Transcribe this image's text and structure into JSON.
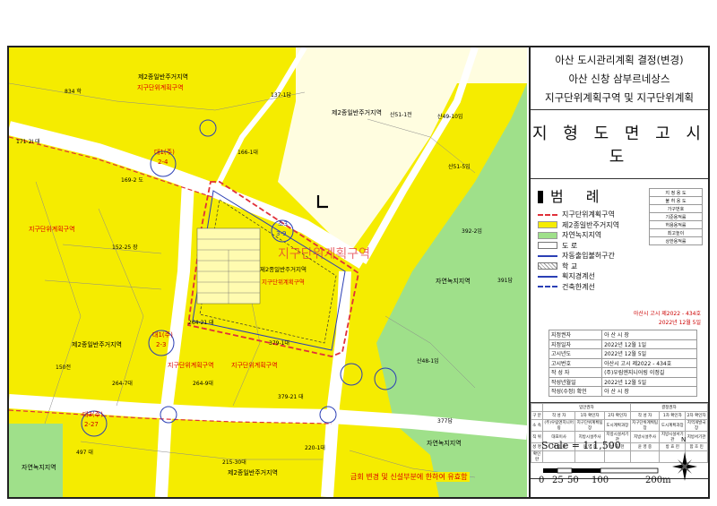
{
  "title": {
    "line1": "아산 도시관리계획 결정(변경)",
    "line2": "아산 신창 삼부르네상스",
    "line3": "지구단위계획구역 및 지구단위계획"
  },
  "subtitle": "지 형 도 면 고 시 도",
  "legend": {
    "heading": "범 례",
    "items": [
      {
        "label": "지구단위계획구역",
        "color": "#e0303a"
      },
      {
        "label": "제2종일반주거지역",
        "color": "#f5ec00"
      },
      {
        "label": "자연녹지지역",
        "color": "#9fe08a"
      },
      {
        "label": "도 로",
        "color": "#ffffff"
      },
      {
        "label": "자동출입불허구간",
        "color": "#2b3fb5"
      },
      {
        "label": "학 교",
        "color": "#ffffff"
      },
      {
        "label": "획지경계선",
        "color": "#2b3fb5"
      },
      {
        "label": "건축한계선",
        "color": "#2b3fb5"
      }
    ],
    "table_rows": [
      "지 정 용 도",
      "불 허 용 도",
      "가구번호",
      "기준용적률",
      "허용용적률",
      "최고높이",
      "상한용적률"
    ],
    "table_right": [
      "",
      "",
      "",
      "",
      "",
      "",
      ""
    ]
  },
  "notice": {
    "line1": "아산시 고시 제2022 - 434호",
    "line2": "2022년  12월  5일"
  },
  "info_rows": [
    {
      "k": "지정권자",
      "v": "아 산 시 장"
    },
    {
      "k": "지정일자",
      "v": "2022년  12월  1일"
    },
    {
      "k": "고시년도",
      "v": "2022년  12월  5일"
    },
    {
      "k": "고시번호",
      "v": "아산시 고시 제2022 - 434호"
    },
    {
      "k": "작 성 자",
      "v": "(주)우림엔지니어링 이정길"
    },
    {
      "k": "작성년월일",
      "v": "2022년  12월  5일"
    },
    {
      "k": "작성(수정) 확인",
      "v": "아 산 시 장"
    }
  ],
  "signatures": {
    "headers": [
      "입안권자",
      "결정권자"
    ],
    "rows": [
      [
        "구 분",
        "작 성 자",
        "1차 확인자",
        "2차 확인자",
        "작 성 자",
        "1차 확인자",
        "2차 확인자"
      ],
      [
        "소 속",
        "(주)우림엔지니어링",
        "지구단위계획팀장",
        "도시계획과장",
        "지구단위계획팀장",
        "도시계획과장",
        "지역개발국장"
      ],
      [
        "직 위",
        "대표이사",
        "지방시설주사",
        "지방시설서기관",
        "지방시설주사",
        "지방시설서기관",
        "지방서기관"
      ],
      [
        "성 명",
        "이 정 길",
        "윤 영 중",
        "방 효 헌",
        "윤 영 중",
        "방 효 헌",
        "함 호 민"
      ],
      [
        "확인란",
        "",
        "",
        "",
        "",
        "",
        ""
      ]
    ]
  },
  "scale": {
    "text": "Scale = 1:1,500",
    "ticks": [
      "0",
      "25",
      "50",
      "100",
      "200m"
    ],
    "north": "N"
  },
  "map": {
    "bottom_note": "금회 변경 및 신설부분에 한하여 유효함",
    "zone_labels": [
      "제2종일반주거지역",
      "지구단위계획구역",
      "제2종일반주거지역",
      "지구단위계획구역",
      "제2종일반주거지역",
      "지구단위계획구역",
      "자연녹지지역",
      "지구단위계획구역",
      "제2종일반주거지역",
      "지구단위계획구역",
      "자연녹지지역",
      "제2종일반주거지역",
      "지구단위계획구역",
      "자연녹지지역"
    ],
    "road_labels": [
      "대1(주)",
      "2-4",
      "대1(주)",
      "2-3",
      "대3(주)",
      "2-27",
      "소3",
      "3-9"
    ],
    "parcels": [
      "834 학",
      "137-1답",
      "산51-1전",
      "산49-10임",
      "171-2I 대",
      "166-1대",
      "169-2 도",
      "산51-5임",
      "152-25 장",
      "392-2임",
      "391답",
      "264-21 대",
      "150전",
      "264-7대",
      "264-9대",
      "379-1대",
      "산48-1임",
      "377답",
      "497 대",
      "220-1대",
      "215-30대",
      "379-21 대"
    ],
    "colors": {
      "residential": "#f5ec00",
      "green": "#9fe08a",
      "road": "#ffffff",
      "boundary": "#e0303a",
      "line": "#2b3fb5"
    }
  }
}
